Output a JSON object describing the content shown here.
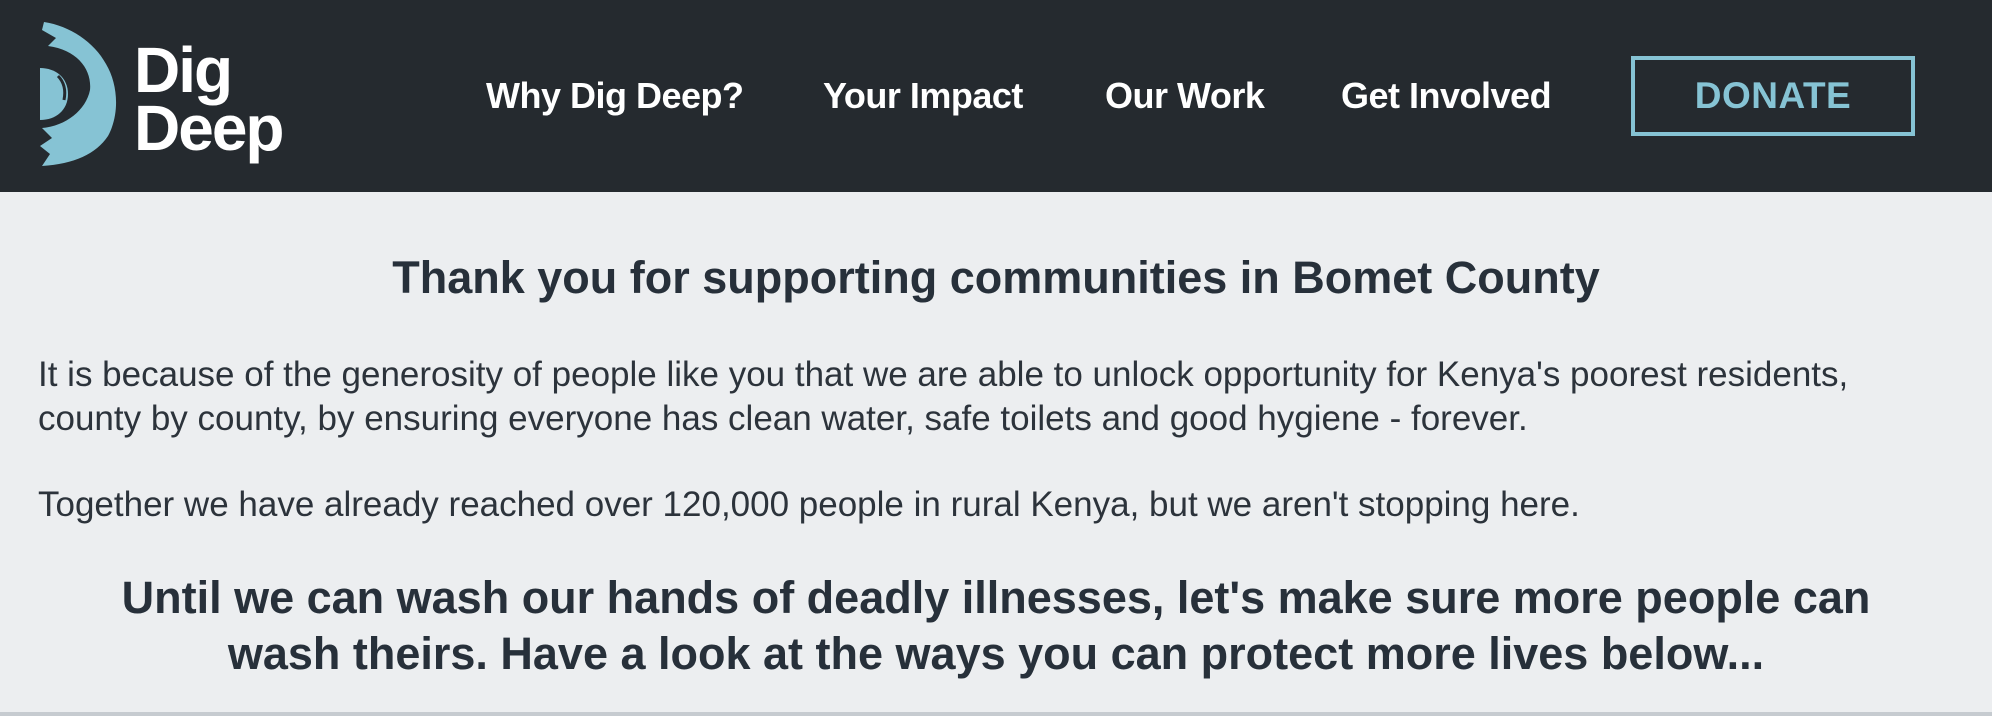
{
  "brand": {
    "logo_line1": "Dig",
    "logo_line2": "Deep",
    "accent_color": "#86c3d4",
    "header_color": "#252a2f"
  },
  "nav": {
    "items": [
      {
        "label": "Why Dig Deep?"
      },
      {
        "label": "Your Impact"
      },
      {
        "label": "Our Work"
      },
      {
        "label": "Get Involved"
      }
    ],
    "donate_label": "DONATE"
  },
  "main": {
    "heading": "Thank you for supporting communities in Bomet County",
    "paragraph1": "It is because of the generosity of people like you that we are able to unlock opportunity for Kenya's poorest residents, county by county, by ensuring everyone has clean water, safe toilets and good hygiene - forever.",
    "paragraph2": "Together we have already reached over 120,000 people in rural Kenya, but we aren't stopping here.",
    "callout": "Until we can wash our hands of deadly illnesses, let's make sure more people can wash theirs. Have a look at the ways you can protect more lives below..."
  }
}
